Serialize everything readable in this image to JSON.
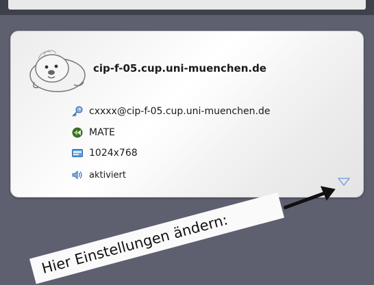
{
  "session": {
    "hostname": "cip-f-05.cup.uni-muenchen.de",
    "user": "cxxxx@cip-f-05.cup.uni-muenchen.de",
    "desktop": "MATE",
    "resolution": "1024x768",
    "sound": "aktiviert"
  },
  "icons": {
    "avatar": "seal-avatar-icon",
    "user": "key-icon",
    "desktop": "mate-logo-icon",
    "resolution": "display-icon",
    "sound": "speaker-icon",
    "expander": "triangle-down-icon"
  },
  "annotation": {
    "text": "Hier Einstellungen ändern:"
  }
}
